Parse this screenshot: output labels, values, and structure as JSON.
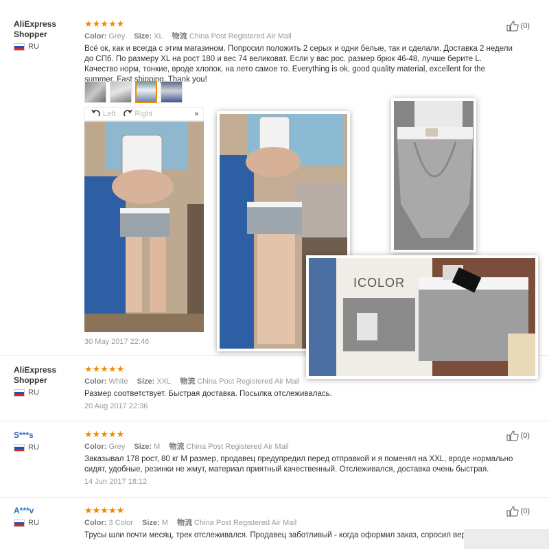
{
  "reviews": [
    {
      "user": "AliExpress Shopper",
      "country": "RU",
      "stars": "★★★★★",
      "color_label": "Color:",
      "color": "Grey",
      "size_label": "Size:",
      "size": "XL",
      "shipping_label": "物流",
      "shipping": "China Post Registered Air Mail",
      "text": "Всё ок, как и всегда с этим магазином. Попросил положить 2 серых и одни белые, так и сделали. Доставка 2 недели до СПб. По размеру XL на рост 180 и вес 74 великоват. Если у вас рос. размер брюк 46-48, лучше берите L. Качество норм, тонкие, вроде хлопок, на лето самое то. Everything is ok, good quality material, excellent for the summer. Fast shipping. Thank you!",
      "date": "30 May 2017 22:46",
      "helpful": "(0)"
    },
    {
      "user": "AliExpress Shopper",
      "country": "RU",
      "stars": "★★★★★",
      "color_label": "Color:",
      "color": "White",
      "size_label": "Size:",
      "size": "XXL",
      "shipping_label": "物流",
      "shipping": "China Post Registered Air Mail",
      "text": "Размер соответствует. Быстрая доставка. Посылка отслеживалась.",
      "date": "20 Aug 2017 22:36"
    },
    {
      "user": "S***s",
      "country": "RU",
      "stars": "★★★★★",
      "color_label": "Color:",
      "color": "Grey",
      "size_label": "Size:",
      "size": "M",
      "shipping_label": "物流",
      "shipping": "China Post Registered Air Mail",
      "text": "Заказывал 178 рост, 80 кг М размер, продавец предупредил перед отправкой и я поменял на XXL, вроде нормально сидят, удобные, резинки не жмут, материал приятный качественный. Отслеживался, доставка очень быстрая.",
      "date": "14 Jun 2017 18:12",
      "helpful": "(0)"
    },
    {
      "user": "A***v",
      "country": "RU",
      "stars": "★★★★★",
      "color_label": "Color:",
      "color": "3 Color",
      "size_label": "Size:",
      "size": "M",
      "shipping_label": "物流",
      "shipping": "China Post Registered Air Mail",
      "text": "Трусы шли почти месяц, трек отслеживался. Продавец заботливый - когда оформил заказ, спросил верно",
      "helpful": "(0)"
    }
  ],
  "viewer": {
    "left_label": "Left",
    "right_label": "Right",
    "close": "×"
  },
  "box_brand": "ICOLOR"
}
